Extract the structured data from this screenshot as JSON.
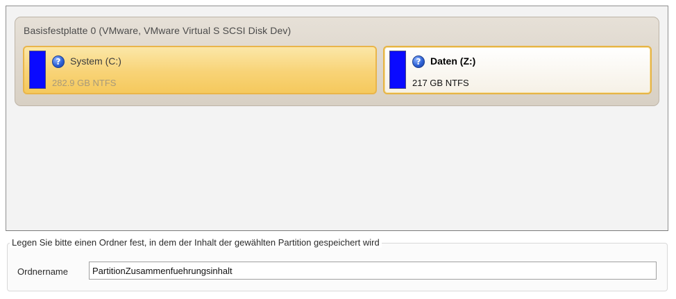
{
  "disk": {
    "title": "Basisfestplatte 0 (VMware, VMware Virtual S SCSI Disk Dev)",
    "partitions": [
      {
        "name": "System (C:)",
        "info": "282.9 GB NTFS",
        "icon": "help-icon",
        "selected": true
      },
      {
        "name": "Daten (Z:)",
        "info": "217 GB NTFS",
        "icon": "help-icon",
        "selected": false
      }
    ]
  },
  "folder": {
    "legend": "Legen Sie bitte einen Ordner fest, in dem der Inhalt der gewählten Partition gespeichert wird",
    "label": "Ordnername",
    "value": "PartitionZusammenfuehrungsinhalt"
  },
  "colors": {
    "usage_bar": "#0a0aff",
    "selected_partition": "#f8d376",
    "partition_border": "#e8b447"
  }
}
